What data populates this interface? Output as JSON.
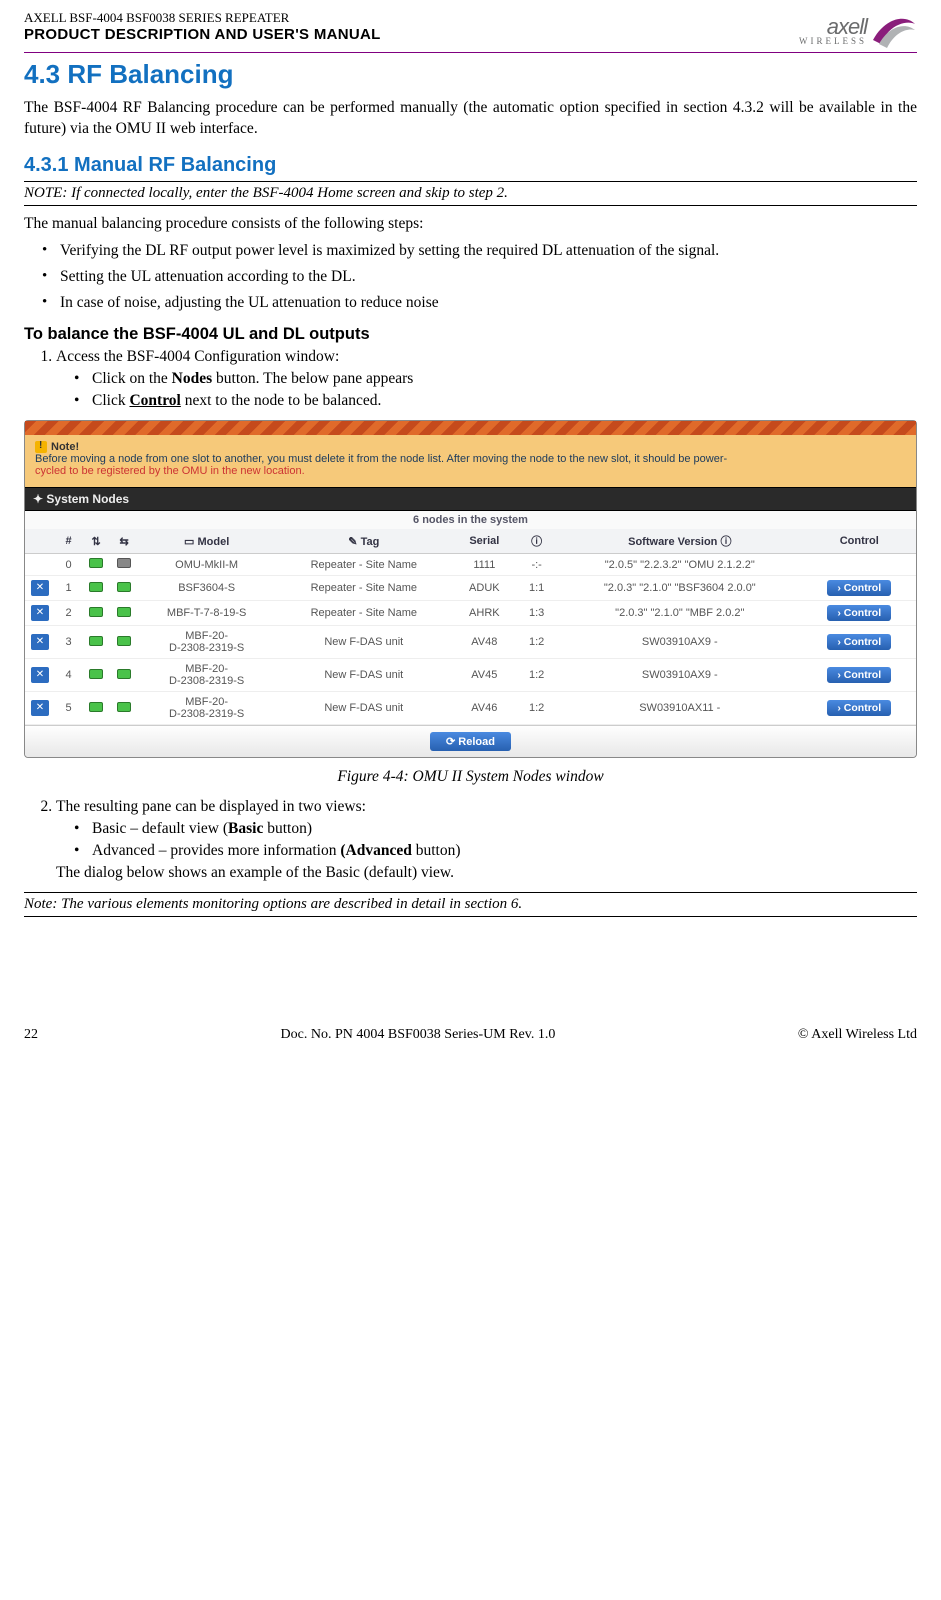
{
  "header": {
    "small_title": "AXELL BSF-4004 BSF0038 SERIES REPEATER",
    "subtitle": "PRODUCT DESCRIPTION AND USER'S MANUAL",
    "logo_text": "axell",
    "logo_sub": "WIRELESS"
  },
  "section": {
    "num_title": "4.3  RF Balancing",
    "intro": "The BSF-4004 RF Balancing procedure can be performed manually (the automatic option specified in section 4.3.2 will be available in the future) via the OMU II web interface."
  },
  "subsection": {
    "num_title": "4.3.1   Manual RF Balancing",
    "note": "NOTE: If connected locally, enter the BSF-4004 Home screen and skip to step 2.",
    "lead": "The manual balancing procedure consists of the following steps:",
    "bullets": [
      "Verifying the DL RF output power level is maximized by setting the required DL attenuation of the signal.",
      "Setting the UL attenuation according to the DL.",
      "In case of noise, adjusting the UL attenuation to reduce noise"
    ],
    "proc_heading": "To balance the BSF-4004 UL and DL outputs",
    "step1": "Access the BSF-4004 Configuration window:",
    "step1_sub": {
      "a_pre": "Click on the ",
      "a_bold": "Nodes",
      "a_post": " button. The below pane appears",
      "b_pre": "Click ",
      "b_bold": "Control",
      "b_post": " next to the node to be balanced."
    },
    "figure_caption": "Figure 4-4: OMU II System Nodes window",
    "step2": "The resulting pane can be displayed in two views:",
    "step2_sub": {
      "a_pre": "Basic – default view (",
      "a_bold": "Basic",
      "a_post": " button)",
      "b_pre": "Advanced – provides more information ",
      "b_bold": "(Advanced",
      "b_post": " button)"
    },
    "step2_tail": "The dialog below shows an example of the Basic (default) view.",
    "note2": "Note: The various elements monitoring options are described in detail in section 6."
  },
  "screenshot": {
    "note_title": "Note!",
    "note_line1": "Before moving a node from one slot to another, you must delete it from the node list. After moving the node to the new slot, it should be power-",
    "note_line2": "cycled to be registered by the OMU in the new location.",
    "nodes_header": "System Nodes",
    "count_text": "6 nodes in the system",
    "columns": {
      "hash": "#",
      "model": "Model",
      "tag": "Tag",
      "serial": "Serial",
      "sw": "Software Version",
      "control": "Control"
    },
    "rows": [
      {
        "del": false,
        "num": "0",
        "s1": "on",
        "s2": "off",
        "model": "OMU-MkII-M",
        "tag": "Repeater - Site Name",
        "serial": "1111",
        "slot": "-:-",
        "sw": "\"2.0.5\" \"2.2.3.2\" \"OMU 2.1.2.2\"",
        "ctrl": false
      },
      {
        "del": true,
        "num": "1",
        "s1": "on",
        "s2": "on",
        "model": "BSF3604-S",
        "tag": "Repeater - Site Name",
        "serial": "ADUK",
        "slot": "1:1",
        "sw": "\"2.0.3\" \"2.1.0\" \"BSF3604 2.0.0\"",
        "ctrl": true
      },
      {
        "del": true,
        "num": "2",
        "s1": "on",
        "s2": "on",
        "model": "MBF-T-7-8-19-S",
        "tag": "Repeater - Site Name",
        "serial": "AHRK",
        "slot": "1:3",
        "sw": "\"2.0.3\" \"2.1.0\" \"MBF 2.0.2\"",
        "ctrl": true
      },
      {
        "del": true,
        "num": "3",
        "s1": "on",
        "s2": "on",
        "model": "MBF-20-D-2308-2319-S",
        "tag": "New F-DAS unit",
        "serial": "AV48",
        "slot": "1:2",
        "sw": "SW03910AX9 -",
        "ctrl": true
      },
      {
        "del": true,
        "num": "4",
        "s1": "on",
        "s2": "on",
        "model": "MBF-20-D-2308-2319-S",
        "tag": "New F-DAS unit",
        "serial": "AV45",
        "slot": "1:2",
        "sw": "SW03910AX9 -",
        "ctrl": true
      },
      {
        "del": true,
        "num": "5",
        "s1": "on",
        "s2": "on",
        "model": "MBF-20-D-2308-2319-S",
        "tag": "New F-DAS unit",
        "serial": "AV46",
        "slot": "1:2",
        "sw": "SW03910AX11 -",
        "ctrl": true
      }
    ],
    "control_label": "Control",
    "reload_label": "Reload"
  },
  "footer": {
    "page": "22",
    "doc": "Doc. No. PN 4004 BSF0038 Series-UM Rev. 1.0",
    "copyright": "© Axell Wireless Ltd"
  }
}
